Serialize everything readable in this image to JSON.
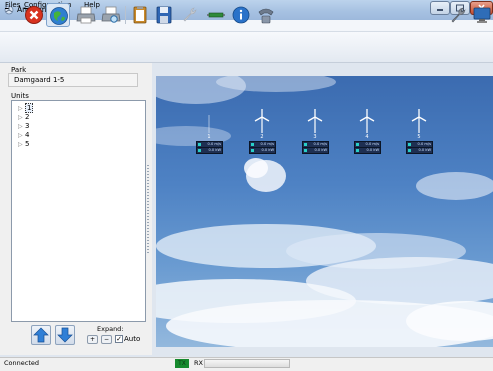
{
  "window": {
    "title": "Andromeda"
  },
  "menu": [
    "Files",
    "Configuration",
    "Help"
  ],
  "toolbar": {
    "left_icons": [
      "stop-icon",
      "globe-icon",
      "printer-icon",
      "printer-preview-icon",
      "clipboard-icon",
      "save-icon",
      "wrench-disabled-icon",
      "cable-icon",
      "info-icon",
      "phone-icon"
    ],
    "right_icons": [
      "tools-icon",
      "monitor-icon"
    ]
  },
  "left": {
    "park_label": "Park",
    "park_value": "Damgaard 1-5",
    "units_label": "Units",
    "units": [
      "1",
      "2",
      "3",
      "4",
      "5"
    ],
    "expand_label": "Expand:",
    "expand_plus": "+",
    "expand_minus": "−",
    "auto_label": "Auto",
    "auto_checked": true
  },
  "turbines": [
    {
      "number": "1",
      "wind": "0.0 m/s",
      "power": "0.0 kW"
    },
    {
      "number": "2",
      "wind": "0.0 m/s",
      "power": "0.0 kW"
    },
    {
      "number": "3",
      "wind": "0.0 m/s",
      "power": "0.0 kW"
    },
    {
      "number": "4",
      "wind": "0.0 m/s",
      "power": "0.0 kW"
    },
    {
      "number": "5",
      "wind": "0.0 m/s",
      "power": "0.0 kW"
    }
  ],
  "status": {
    "text": "Connected",
    "tx": "TX",
    "rx": "RX"
  },
  "colors": {
    "tx_active": "#168a2e",
    "sky": "#4e82c4",
    "badge": "#1e2f52"
  }
}
